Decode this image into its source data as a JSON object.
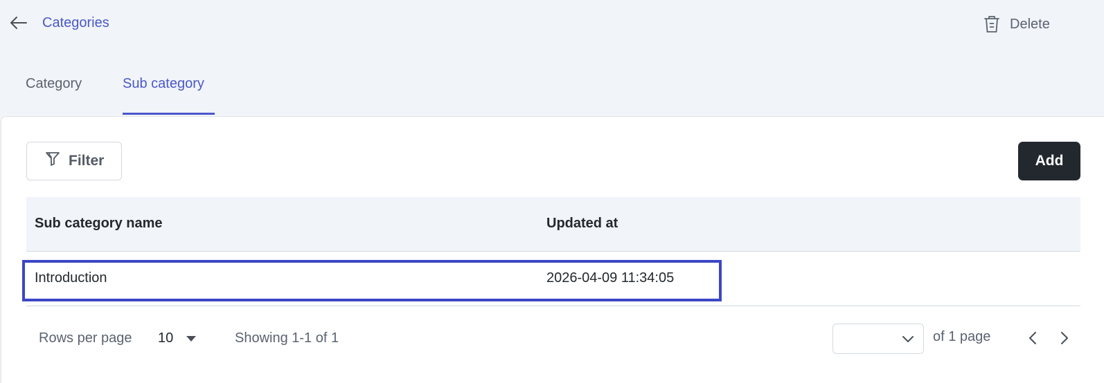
{
  "header": {
    "breadcrumb": "Categories",
    "delete_label": "Delete"
  },
  "tabs": [
    {
      "label": "Category",
      "active": false
    },
    {
      "label": "Sub category",
      "active": true
    }
  ],
  "toolbar": {
    "filter_label": "Filter",
    "add_label": "Add"
  },
  "table": {
    "columns": [
      "Sub category name",
      "Updated at"
    ],
    "rows": [
      {
        "name": "Introduction",
        "updated_at": "2026-04-09 11:34:05"
      }
    ]
  },
  "pagination": {
    "rows_per_page_label": "Rows per page",
    "rows_per_page_value": "10",
    "showing_text": "Showing 1-1 of 1",
    "page_value": "",
    "of_pages_text": "of 1 page"
  },
  "colors": {
    "accent": "#4a58c9",
    "highlight_border": "#3b47c4",
    "primary_button": "#23282e",
    "background": "#f1f4f8"
  },
  "icons": {
    "back": "arrow-left-icon",
    "delete": "trash-icon",
    "filter": "filter-icon",
    "rows_dropdown": "caret-down-icon",
    "page_dropdown": "chevron-down-icon",
    "prev": "chevron-left-icon",
    "next": "chevron-right-icon"
  }
}
